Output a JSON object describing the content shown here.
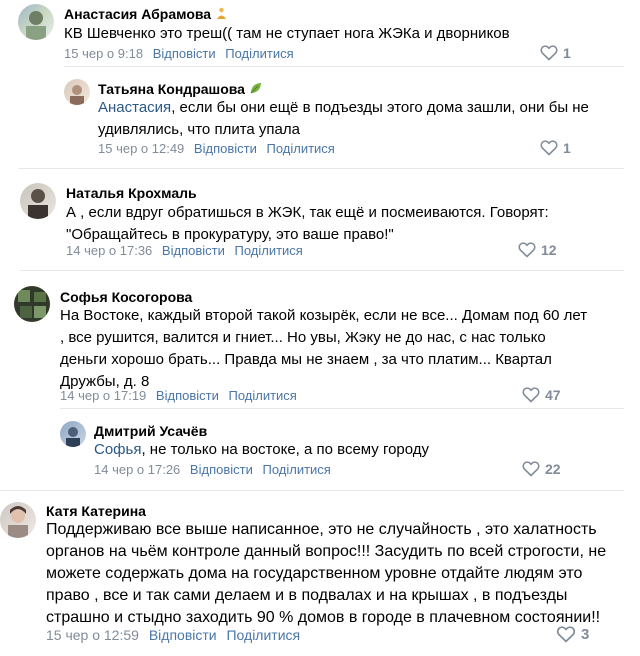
{
  "comments": [
    {
      "name": "Анастасия Абрамова",
      "text": "КВ Шевченко это треш(( там не ступает нога ЖЭКа и дворников",
      "date": "15 чер о 9:18",
      "reply": "Відповісти",
      "share": "Поділитися",
      "likes": "1",
      "replies": [
        {
          "name": "Татьяна Кондрашова",
          "mention": "Анастасия",
          "text_line1": ", если бы они ещё в подъезды этого дома зашли, они бы не",
          "text_line2": "удивлялись, что плита упала",
          "date": "15 чер о 12:49",
          "reply": "Відповісти",
          "share": "Поділитися",
          "likes": "1"
        }
      ]
    },
    {
      "name": "Наталья Крохмаль",
      "text_line1": "А , если вдруг обратишься в ЖЭК, так ещё и посмеиваются. Говорят:",
      "text_line2": "\"Обращайтесь в прокуратуру, это ваше право!\"",
      "date": "14 чер о 17:36",
      "reply": "Відповісти",
      "share": "Поділитися",
      "likes": "12"
    },
    {
      "name": "Софья Косогорова",
      "text_line1": "На Востоке, каждый второй такой козырёк, если не все... Домам под 60 лет",
      "text_line2": ", все рушится, валится и гниет... Но увы, Жэку не до нас, с нас только",
      "text_line3": "деньги хорошо брать... Правда мы не знаем , за что платим... Квартал",
      "text_line4": "Дружбы, д. 8",
      "date": "14 чер о 17:19",
      "reply": "Відповісти",
      "share": "Поділитися",
      "likes": "47",
      "replies": [
        {
          "name": "Дмитрий Усачёв",
          "mention": "Софья",
          "text": ", не только на востоке, а по всему городу",
          "date": "14 чер о 17:26",
          "reply": "Відповісти",
          "share": "Поділитися",
          "likes": "22"
        }
      ]
    },
    {
      "name": "Катя Катерина",
      "text_line1": "Поддерживаю все выше написанное, это не случайность , это халатность",
      "text_line2": "органов на чьём контроле данный вопрос!!! Засудить по всей строгости, не",
      "text_line3": "можете содержать дома на государственном уровне отдайте людям это",
      "text_line4": "право , все и так сами делаем и в подвалах и на крышах , в подъезды",
      "text_line5": "страшно и стыдно заходить 90 % домов в городе в плачевном состоянии!!",
      "date": "15 чер о 12:59",
      "reply": "Відповісти",
      "share": "Поділитися",
      "likes": "3"
    }
  ],
  "icons": {
    "like": "heart-outline-icon"
  },
  "colors": {
    "link": "#2a5885",
    "action": "#4a76a8",
    "meta": "#818c99"
  }
}
